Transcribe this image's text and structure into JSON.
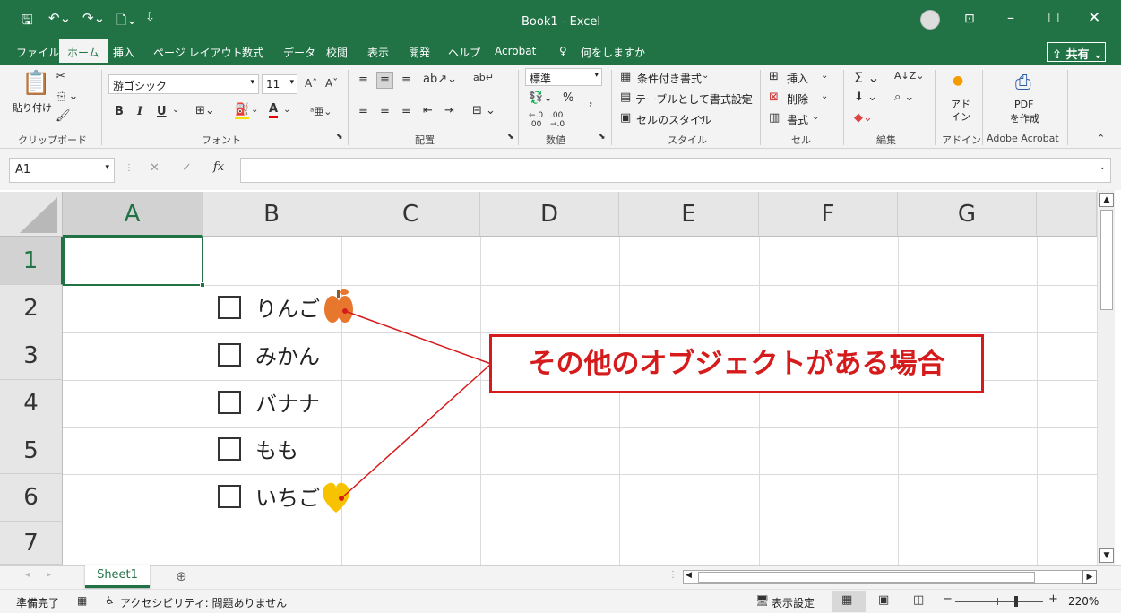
{
  "title": "Book1  -  Excel",
  "quick_access": {
    "save_icon": "save-icon",
    "undo_icon": "undo-icon",
    "redo_icon": "redo-icon",
    "customize_icon": "customize-icon"
  },
  "share_label": "共有",
  "tabs": [
    "ファイル",
    "ホーム",
    "挿入",
    "ページ レイアウト",
    "数式",
    "データ",
    "校閲",
    "表示",
    "開発",
    "ヘルプ",
    "Acrobat",
    "何をしますか"
  ],
  "ribbon": {
    "clipboard": {
      "paste": "貼り付け",
      "label": "クリップボード"
    },
    "font": {
      "name": "游ゴシック",
      "size": "11",
      "label": "フォント",
      "bold": "B",
      "italic": "I",
      "underline": "U"
    },
    "alignment": {
      "label": "配置"
    },
    "number": {
      "format": "標準",
      "percent": "%",
      "comma": "，",
      "label": "数値"
    },
    "styles": {
      "conditional": "条件付き書式",
      "table": "テーブルとして書式設定",
      "cell_styles": "セルのスタイル",
      "label": "スタイル"
    },
    "cells": {
      "insert": "挿入",
      "delete": "削除",
      "format": "書式",
      "label": "セル"
    },
    "editing": {
      "label": "編集"
    },
    "addins": {
      "button": "アド\nイン",
      "label": "アドイン"
    },
    "acrobat": {
      "button1": "PDF",
      "button2": "を作成",
      "label": "Adobe Acrobat"
    }
  },
  "formula_bar": {
    "name_box": "A1",
    "fx": "fx",
    "cancel": "✕",
    "enter": "✓",
    "value": ""
  },
  "columns": [
    "A",
    "B",
    "C",
    "D",
    "E",
    "F",
    "G"
  ],
  "rows": [
    "1",
    "2",
    "3",
    "4",
    "5",
    "6",
    "7"
  ],
  "items": [
    {
      "text": "りんご",
      "icon": "apple-icon"
    },
    {
      "text": "みかん",
      "icon": ""
    },
    {
      "text": "バナナ",
      "icon": ""
    },
    {
      "text": "もも",
      "icon": ""
    },
    {
      "text": "いちご",
      "icon": "heart-icon"
    }
  ],
  "callout": "その他のオブジェクトがある場合",
  "sheet_tab": "Sheet1",
  "status": {
    "ready": "準備完了",
    "accessibility": "アクセシビリティ: 問題ありません",
    "display_settings": "表示設定",
    "zoom": "220%"
  },
  "colors": {
    "excel_green": "#217346",
    "callout_red": "#d51b1b",
    "apple_orange": "#e8772e",
    "heart_yellow": "#f7c300"
  }
}
